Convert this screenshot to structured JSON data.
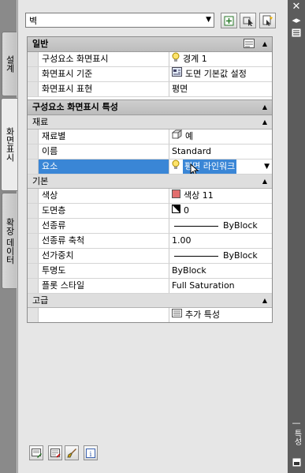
{
  "tabs": {
    "design": "설계",
    "display": "화면표시",
    "extended": "확장 데이터"
  },
  "right_strip": {
    "title": "특성"
  },
  "toolbar": {
    "selection": "벽"
  },
  "sections": {
    "general": {
      "title": "일반"
    },
    "display_props": {
      "title": "구성요소 화면표시 특성"
    },
    "material": {
      "title": "재료"
    },
    "basic": {
      "title": "기본"
    },
    "advanced": {
      "title": "고급"
    }
  },
  "general_rows": [
    {
      "name": "구성요소 화면표시",
      "value": "경계 1"
    },
    {
      "name": "화면표시 기준",
      "value": "도면 기본값 설정"
    },
    {
      "name": "화면표시 표현",
      "value": "평면"
    }
  ],
  "material_rows": [
    {
      "name": "재료별",
      "value": "예"
    },
    {
      "name": "이름",
      "value": "Standard"
    },
    {
      "name": "요소",
      "value": "평면 라인워크"
    }
  ],
  "basic_rows": [
    {
      "name": "색상",
      "value": "색상 11"
    },
    {
      "name": "도면층",
      "value": "0"
    },
    {
      "name": "선종류",
      "value": "ByBlock"
    },
    {
      "name": "선종류 축척",
      "value": "1.00"
    },
    {
      "name": "선가중치",
      "value": "ByBlock"
    },
    {
      "name": "투명도",
      "value": "ByBlock"
    },
    {
      "name": "플롯 스타일",
      "value": "Full Saturation"
    }
  ],
  "advanced_rows": [
    {
      "name": "",
      "value": "추가 특성"
    }
  ],
  "colors": {
    "selected_row": "#3a86d6",
    "color_swatch": "#e26f6f"
  }
}
